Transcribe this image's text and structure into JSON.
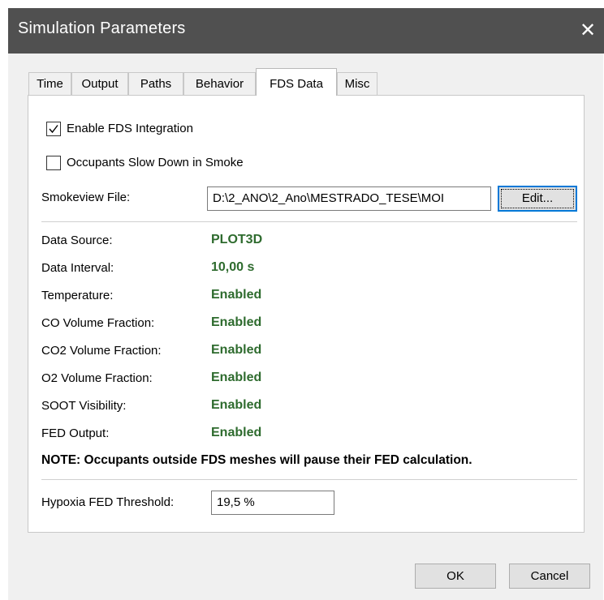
{
  "window": {
    "title": "Simulation Parameters",
    "close_glyph": "✕"
  },
  "tabs": [
    "Time",
    "Output",
    "Paths",
    "Behavior",
    "FDS Data",
    "Misc"
  ],
  "active_tab": "FDS Data",
  "checkboxes": {
    "enable_fds": {
      "label": "Enable FDS Integration",
      "checked": true
    },
    "slow_down": {
      "label": "Occupants Slow Down in Smoke",
      "checked": false
    }
  },
  "smokeview": {
    "label": "Smokeview File:",
    "value": "D:\\2_ANO\\2_Ano\\MESTRADO_TESE\\MOI",
    "edit_label": "Edit..."
  },
  "properties": [
    {
      "label": "Data Source:",
      "value": "PLOT3D"
    },
    {
      "label": "Data Interval:",
      "value": "10,00 s"
    },
    {
      "label": "Temperature:",
      "value": "Enabled"
    },
    {
      "label": "CO Volume Fraction:",
      "value": "Enabled"
    },
    {
      "label": "CO2 Volume Fraction:",
      "value": "Enabled"
    },
    {
      "label": "O2 Volume Fraction:",
      "value": "Enabled"
    },
    {
      "label": "SOOT Visibility:",
      "value": "Enabled"
    },
    {
      "label": "FED Output:",
      "value": "Enabled"
    }
  ],
  "note": "NOTE: Occupants outside FDS meshes will pause their FED calculation.",
  "hypoxia": {
    "label": "Hypoxia FED Threshold:",
    "value": "19,5 %"
  },
  "buttons": {
    "ok": "OK",
    "cancel": "Cancel"
  },
  "colors": {
    "titlebar": "#505050",
    "value_green": "#2e6b2e",
    "focus_blue": "#0078d7"
  }
}
